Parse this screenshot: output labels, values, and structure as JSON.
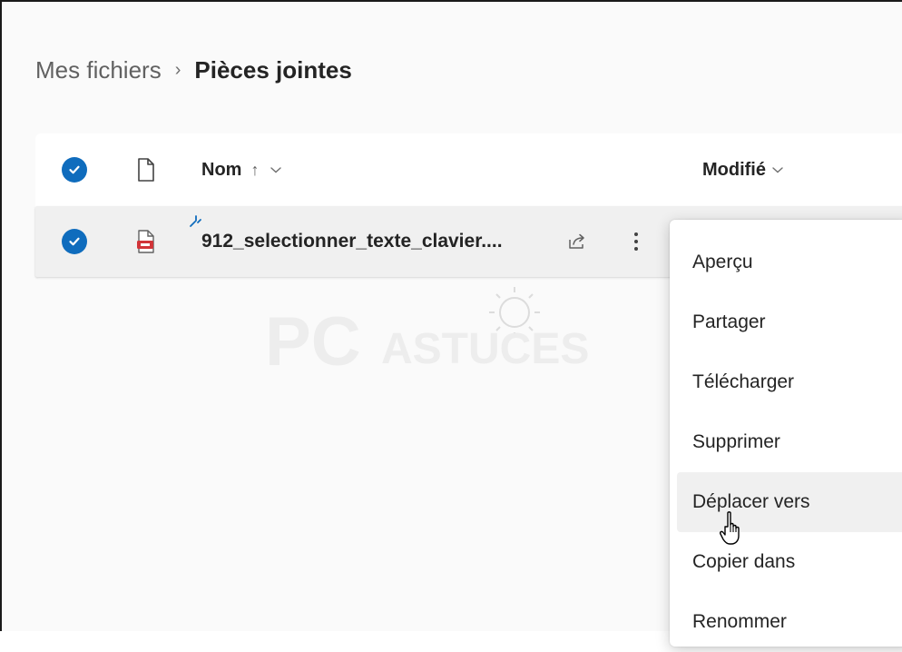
{
  "breadcrumb": {
    "parent": "Mes fichiers",
    "separator": "›",
    "current": "Pièces jointes"
  },
  "file_list": {
    "columns": {
      "name": "Nom",
      "name_sort_indicator": "↑",
      "modified": "Modifié"
    },
    "rows": [
      {
        "name": "912_selectionner_texte_clavier....",
        "selected": true,
        "file_type_icon": "pdf-file-icon"
      }
    ]
  },
  "context_menu": {
    "items": [
      {
        "label": "Aperçu"
      },
      {
        "label": "Partager"
      },
      {
        "label": "Télécharger"
      },
      {
        "label": "Supprimer"
      },
      {
        "label": "Déplacer vers",
        "hovered": true
      },
      {
        "label": "Copier dans"
      },
      {
        "label": "Renommer"
      }
    ]
  },
  "watermark": {
    "text_large": "PC",
    "text_small": "ASTUCES"
  },
  "colors": {
    "accent": "#0f6cbd",
    "pdf_red": "#d13438",
    "row_selected_bg": "#f0f0f0",
    "menu_hover_bg": "#f0f0f0"
  }
}
